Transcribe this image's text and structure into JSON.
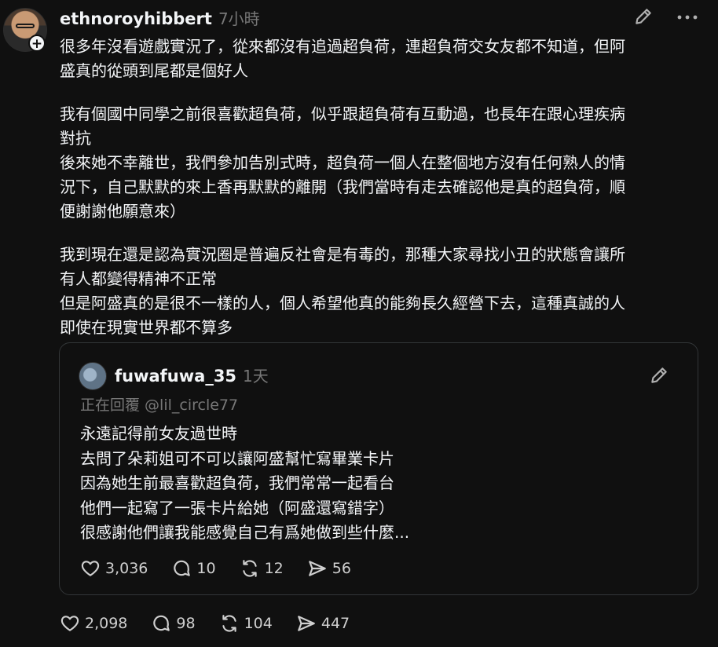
{
  "post": {
    "username": "ethnoroyhibbert",
    "time": "7小時",
    "paragraphs": [
      "很多年沒看遊戲實況了，從來都沒有追過超負荷，連超負荷交女友都不知道，但阿\n盛真的從頭到尾都是個好人",
      "我有個國中同學之前很喜歡超負荷，似乎跟超負荷有互動過，也長年在跟心理疾病\n對抗\n後來她不幸離世，我們參加告別式時，超負荷一個人在整個地方沒有任何熟人的情\n況下，自己默默的來上香再默默的離開（我們當時有走去確認他是真的超負荷，順\n便謝謝他願意來）",
      "我到現在還是認為實況圈是普遍反社會是有毒的，那種大家尋找小丑的狀態會讓所\n有人都變得精神不正常\n但是阿盛真的是很不一樣的人，個人希望他真的能夠長久經營下去，這種真誠的人\n即使在現實世界都不算多"
    ],
    "actions": {
      "likes": "2,098",
      "comments": "98",
      "reposts": "104",
      "shares": "447"
    }
  },
  "quote": {
    "username": "fuwafuwa_35",
    "time": "1天",
    "reply_to": "正在回覆 @lil_circle77",
    "lines": [
      "永遠記得前女友過世時",
      "去問了朵莉姐可不可以讓阿盛幫忙寫畢業卡片",
      "因為她生前最喜歡超負荷，我們常常一起看台",
      "他們一起寫了一張卡片給她（阿盛還寫錯字）",
      "很感謝他們讓我能感覺自己有爲她做到些什麼..."
    ],
    "actions": {
      "likes": "3,036",
      "comments": "10",
      "reposts": "12",
      "shares": "56"
    }
  },
  "icons": [
    "heart-icon",
    "comment-icon",
    "repost-icon",
    "share-icon",
    "edit-icon",
    "more-icon",
    "follow-plus-icon"
  ]
}
